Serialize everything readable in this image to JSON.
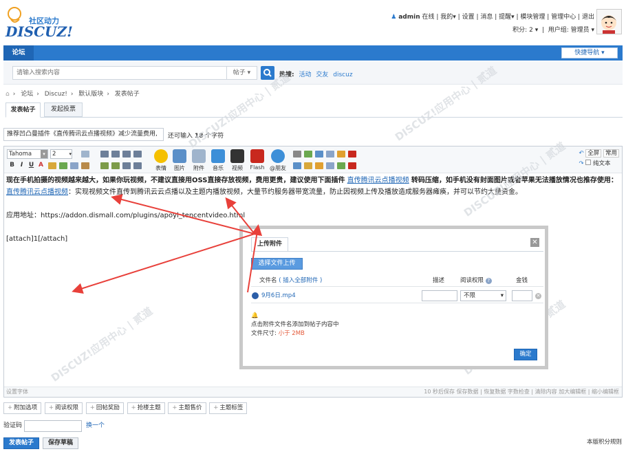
{
  "logo": {
    "top": "社区动力",
    "main": "DISCUZ!"
  },
  "topbar": {
    "user": "admin",
    "status": "在线",
    "my": "我的",
    "settings": "设置",
    "messages": "消息",
    "remind": "提醒",
    "modules": "模块管理",
    "admin_center": "管理中心",
    "logout": "退出",
    "credits_label": "积分:",
    "credits_value": "2",
    "usergroup": "用户组: 管理员"
  },
  "nav": {
    "forum_tab": "论坛",
    "quick_nav": "快捷导航"
  },
  "search": {
    "placeholder": "请输入搜索内容",
    "type": "帖子",
    "hot_label": "热搜:",
    "hot": [
      "活动",
      "交友",
      "discuz"
    ]
  },
  "breadcrumb": [
    "论坛",
    "Discuz!",
    "默认版块",
    "发表帖子"
  ],
  "tabs": [
    "发表帖子",
    "发起投票"
  ],
  "subject": {
    "value": "推荐凹凸曼插件《直传腾讯云点播视频》减少流量费用,",
    "count_pre": "还可输入",
    "count": "18",
    "count_post": "个字符"
  },
  "editor": {
    "font": "Tahoma",
    "size": "2",
    "format_buttons": [
      "B",
      "I",
      "U",
      "A"
    ],
    "insert_labels": [
      "表情",
      "图片",
      "附件",
      "音乐",
      "视频",
      "Flash",
      "@朋友"
    ],
    "right_buttons": {
      "fullscreen": "全屏",
      "common": "常用",
      "plaintext": "纯文本"
    },
    "line1_bold": "现在手机拍摄的视频越来越大，如果你玩视频，不建议直接用OSS直接存放视频，费用更贵，建议使用下面插件",
    "line1_link": "直传腾讯云点播视频",
    "line1_tail": "转码压缩，如手机没有封面图片或者苹果无法播放情况也推存使用：",
    "line2_link": "直传腾讯云点播视频",
    "line2_text": "：实现视频文件直传到腾讯云云点播以及主题内播放视频，大量节约服务器带宽流量，防止因视频上传及播放造成服务器瘫痪，并可以节约大量资金。",
    "line3": "应用地址：https://addon.dismall.com/plugins/apoyl_tencentvideo.html",
    "line4": "[attach]1[/attach]",
    "status_left": "设置字体",
    "status_right": "10 秒后保存 保存数据 | 恢复数据    字数检查 | 清除内容    加大编辑框 | 缩小编辑框"
  },
  "dialog": {
    "title": "上传附件",
    "choose": "选择文件上传",
    "col_file": "文件名",
    "insert_all": "( 插入全部附件 )",
    "col_desc": "描述",
    "col_perm": "阅读权限",
    "col_money": "金钱",
    "file": "9月6日.mp4",
    "perm_value": "不限",
    "tip1": "点击附件文件名添加到帖子内容中",
    "tip2_pre": "文件尺寸:",
    "tip2_val": "小于 2MB",
    "confirm": "确定"
  },
  "options": [
    "附加选项",
    "阅读权限",
    "回帖奖励",
    "抢楼主题",
    "主题售价",
    "主题标签"
  ],
  "verify": {
    "label": "验证码",
    "change": "换一个"
  },
  "actions": {
    "submit": "发表帖子",
    "draft": "保存草稿",
    "rules": "本版积分规则"
  },
  "colors": {
    "accent": "#2b7acd",
    "arrow": "#e8403a"
  }
}
